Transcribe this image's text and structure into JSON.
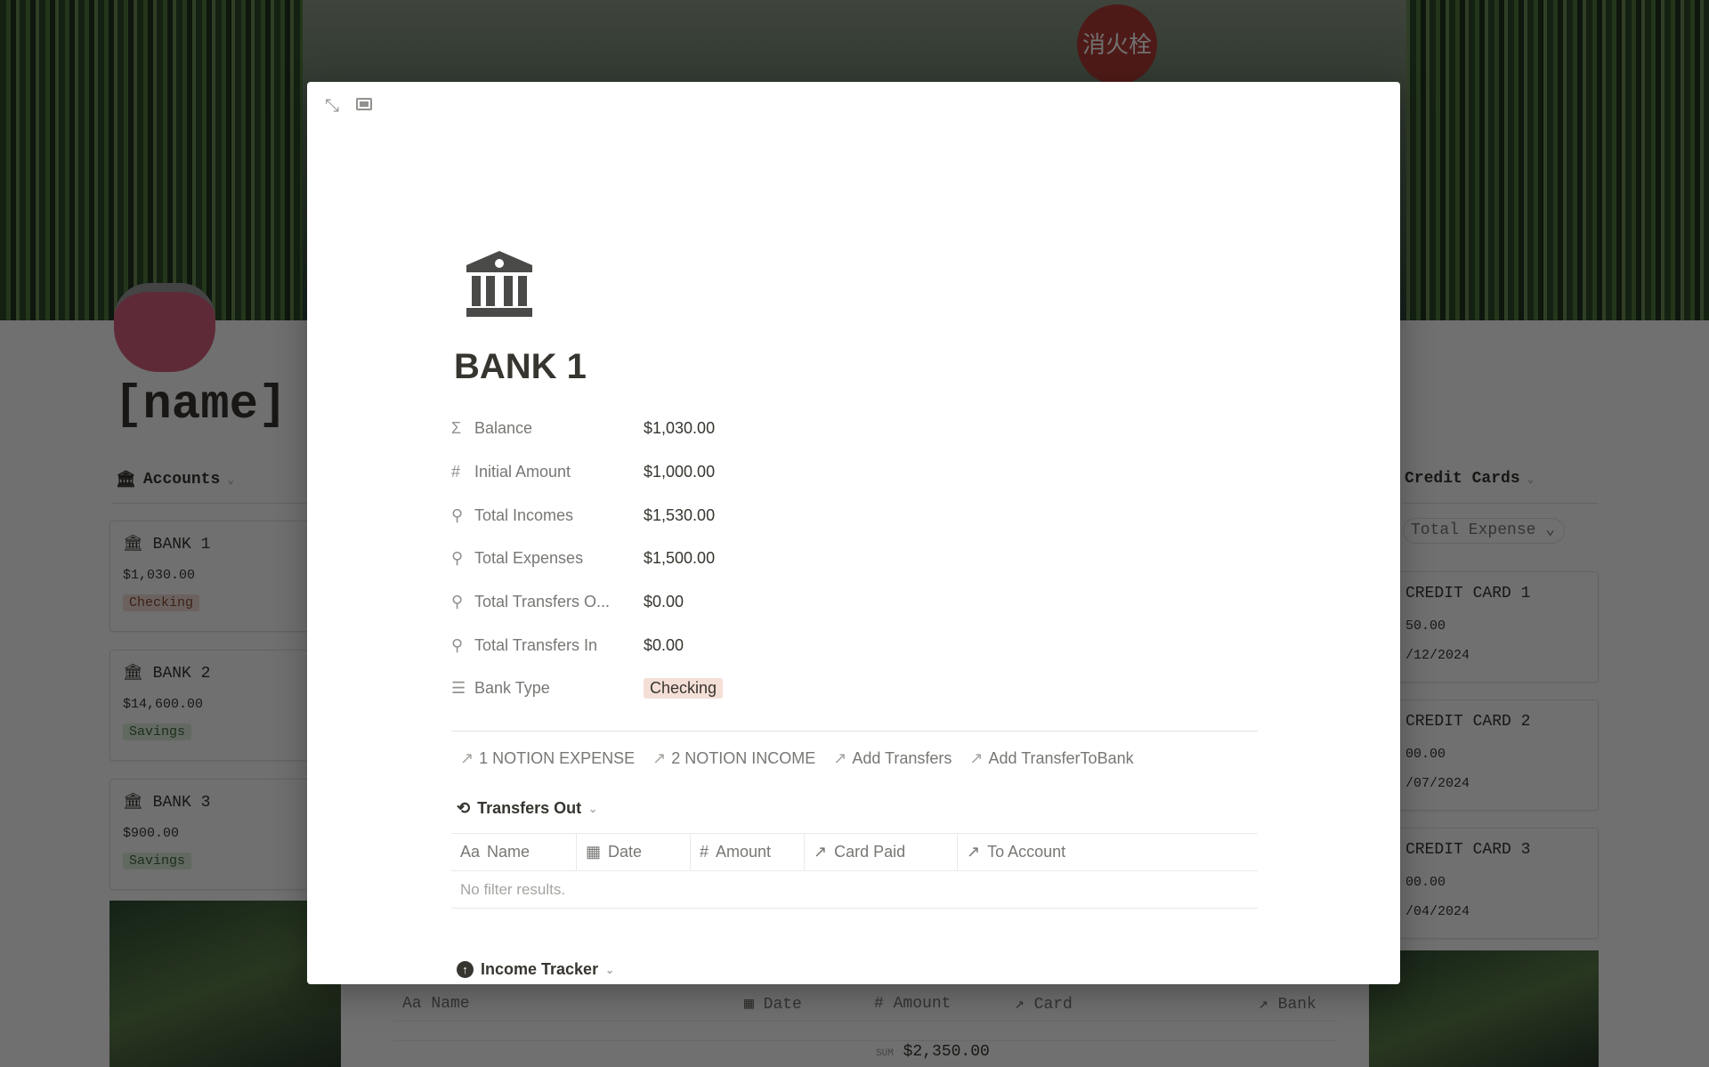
{
  "background": {
    "cover_sign_text": "消火栓",
    "page_title": "[name]",
    "accounts": {
      "title": "Accounts",
      "items": [
        {
          "name": "BANK 1",
          "amount": "$1,030.00",
          "type": "Checking",
          "color": "#f4dfd7"
        },
        {
          "name": "BANK 2",
          "amount": "$14,600.00",
          "type": "Savings",
          "color": "#dfeedd"
        },
        {
          "name": "BANK 3",
          "amount": "$900.00",
          "type": "Savings",
          "color": "#dfeedd"
        }
      ]
    },
    "credit_cards": {
      "title": "Credit Cards",
      "filter": "Total Expense",
      "items": [
        {
          "name": "CREDIT CARD 1",
          "amount": "50.00",
          "date": "/12/2024"
        },
        {
          "name": "CREDIT CARD 2",
          "amount": "00.00",
          "date": "/07/2024"
        },
        {
          "name": "CREDIT CARD 3",
          "amount": "00.00",
          "date": "/04/2024"
        }
      ]
    },
    "income_table": {
      "columns": [
        "Name",
        "Date",
        "Amount",
        "Card",
        "Bank"
      ],
      "sum_label": "SUM",
      "sum": "$2,350.00"
    }
  },
  "modal": {
    "title": "BANK 1",
    "properties": [
      {
        "icon": "sigma",
        "label": "Balance",
        "value": "$1,030.00"
      },
      {
        "icon": "hash",
        "label": "Initial Amount",
        "value": "$1,000.00"
      },
      {
        "icon": "search",
        "label": "Total Incomes",
        "value": "$1,530.00"
      },
      {
        "icon": "search",
        "label": "Total Expenses",
        "value": "$1,500.00"
      },
      {
        "icon": "search",
        "label": "Total Transfers O...",
        "value": "$0.00"
      },
      {
        "icon": "search",
        "label": "Total Transfers In",
        "value": "$0.00"
      },
      {
        "icon": "list",
        "label": "Bank Type",
        "value": "Checking"
      }
    ],
    "links": [
      "1 NOTION EXPENSE",
      "2 NOTION INCOME",
      "Add Transfers",
      "Add TransferToBank"
    ],
    "transfers_out": {
      "title": "Transfers Out",
      "columns": [
        "Name",
        "Date",
        "Amount",
        "Card Paid",
        "To Account"
      ],
      "empty": "No filter results."
    },
    "income_tracker": {
      "title": "Income Tracker"
    }
  }
}
